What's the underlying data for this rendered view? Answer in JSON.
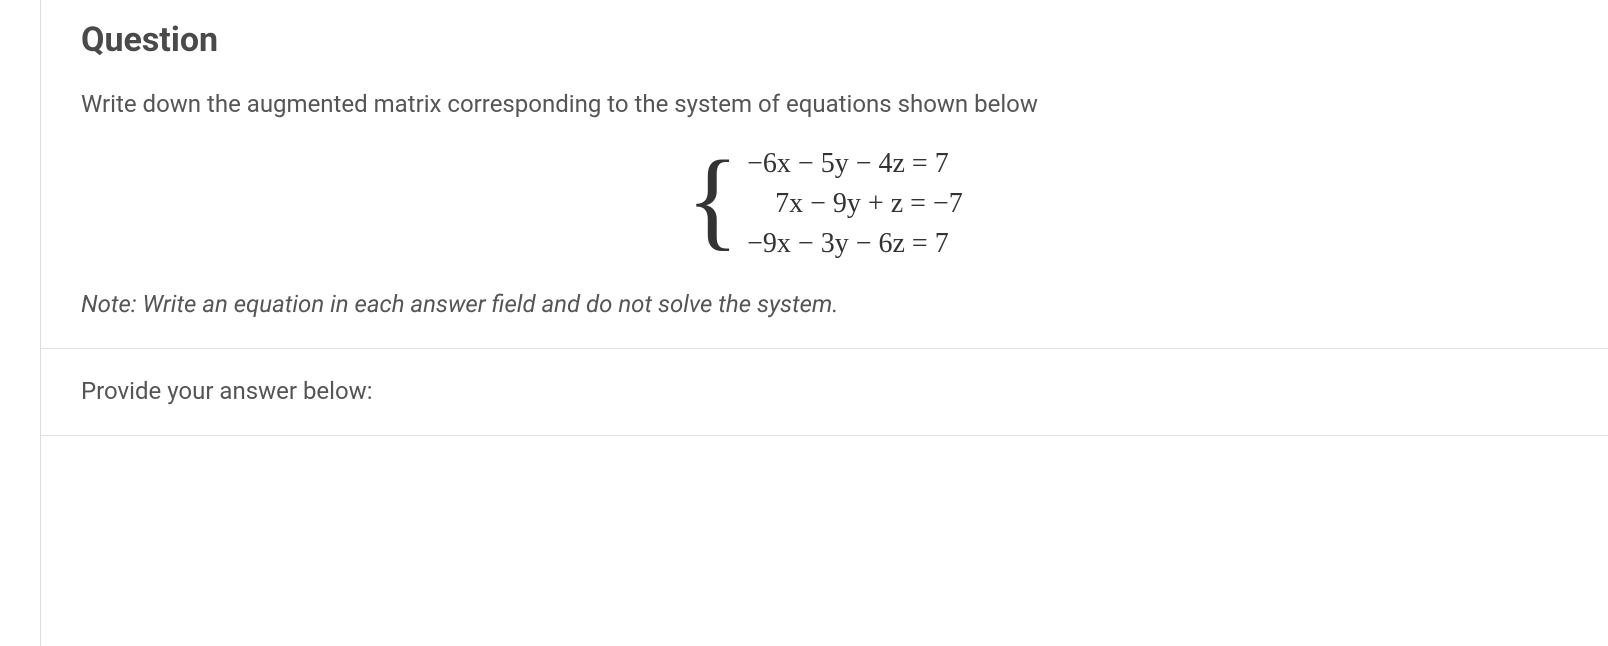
{
  "question": {
    "title": "Question",
    "prompt": "Write down the augmented matrix corresponding to the system of equations shown below",
    "equations": {
      "eq1": "−6x − 5y − 4z = 7",
      "eq2": "7x − 9y + z = −7",
      "eq3": "−9x − 3y − 6z = 7"
    },
    "note": "Note: Write an equation in each answer field and do not solve the system."
  },
  "answer": {
    "prompt": "Provide your answer below:"
  }
}
